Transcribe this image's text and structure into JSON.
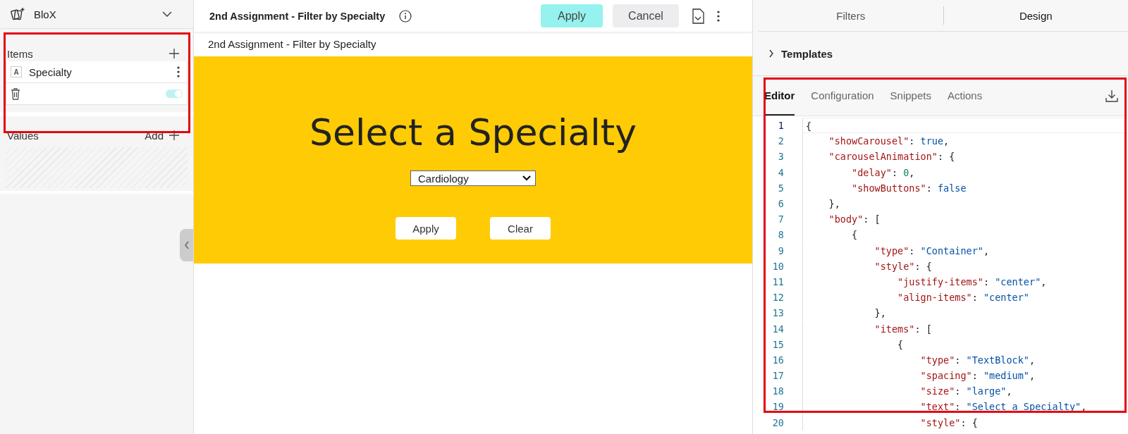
{
  "sidebar": {
    "app_name": "BloX",
    "items_section": {
      "title": "Items",
      "items": [
        {
          "label": "Specialty",
          "type_badge": "A"
        }
      ],
      "toggle": {
        "on": true
      }
    },
    "values_section": {
      "title": "Values",
      "add_label": "Add"
    }
  },
  "header": {
    "title": "2nd Assignment - Filter by Specialty",
    "buttons": [
      {
        "label": "Apply",
        "kind": "primary"
      },
      {
        "label": "Cancel",
        "kind": "secondary"
      }
    ]
  },
  "preview": {
    "caption": "2nd Assignment - Filter by Specialty",
    "heading": "Select a Specialty",
    "dropdown": {
      "value": "Cardiology"
    },
    "buttons": [
      "Apply",
      "Clear"
    ]
  },
  "right_panel": {
    "tabs": [
      {
        "label": "Filters",
        "selected": false
      },
      {
        "label": "Design",
        "selected": true
      }
    ],
    "templates": {
      "label": "Templates",
      "expanded": false
    },
    "editor_tabs": [
      {
        "label": "Editor",
        "selected": true
      },
      {
        "label": "Configuration",
        "selected": false
      },
      {
        "label": "Snippets",
        "selected": false
      },
      {
        "label": "Actions",
        "selected": false
      }
    ],
    "code_lines": [
      {
        "number": "1",
        "current": true,
        "tokens": [
          {
            "kind": "punct",
            "text": "{"
          }
        ]
      },
      {
        "number": "2",
        "current": false,
        "tokens": [
          {
            "kind": "key",
            "text": "    \"showCarousel\""
          },
          {
            "kind": "punct",
            "text": ": "
          },
          {
            "kind": "bool",
            "text": "true"
          },
          {
            "kind": "punct",
            "text": ","
          }
        ]
      },
      {
        "number": "3",
        "current": false,
        "tokens": [
          {
            "kind": "key",
            "text": "    \"carouselAnimation\""
          },
          {
            "kind": "punct",
            "text": ": {"
          }
        ]
      },
      {
        "number": "4",
        "current": false,
        "tokens": [
          {
            "kind": "key",
            "text": "        \"delay\""
          },
          {
            "kind": "punct",
            "text": ": "
          },
          {
            "kind": "num",
            "text": "0"
          },
          {
            "kind": "punct",
            "text": ","
          }
        ]
      },
      {
        "number": "5",
        "current": false,
        "tokens": [
          {
            "kind": "key",
            "text": "        \"showButtons\""
          },
          {
            "kind": "punct",
            "text": ": "
          },
          {
            "kind": "bool",
            "text": "false"
          }
        ]
      },
      {
        "number": "6",
        "current": false,
        "tokens": [
          {
            "kind": "punct",
            "text": "    },"
          }
        ]
      },
      {
        "number": "7",
        "current": false,
        "tokens": [
          {
            "kind": "key",
            "text": "    \"body\""
          },
          {
            "kind": "punct",
            "text": ": ["
          }
        ]
      },
      {
        "number": "8",
        "current": false,
        "tokens": [
          {
            "kind": "punct",
            "text": "        {"
          }
        ]
      },
      {
        "number": "9",
        "current": false,
        "tokens": [
          {
            "kind": "key",
            "text": "            \"type\""
          },
          {
            "kind": "punct",
            "text": ": "
          },
          {
            "kind": "str",
            "text": "\"Container\""
          },
          {
            "kind": "punct",
            "text": ","
          }
        ]
      },
      {
        "number": "10",
        "current": false,
        "tokens": [
          {
            "kind": "key",
            "text": "            \"style\""
          },
          {
            "kind": "punct",
            "text": ": {"
          }
        ]
      },
      {
        "number": "11",
        "current": false,
        "tokens": [
          {
            "kind": "key",
            "text": "                \"justify-items\""
          },
          {
            "kind": "punct",
            "text": ": "
          },
          {
            "kind": "str",
            "text": "\"center\""
          },
          {
            "kind": "punct",
            "text": ","
          }
        ]
      },
      {
        "number": "12",
        "current": false,
        "tokens": [
          {
            "kind": "key",
            "text": "                \"align-items\""
          },
          {
            "kind": "punct",
            "text": ": "
          },
          {
            "kind": "str",
            "text": "\"center\""
          }
        ]
      },
      {
        "number": "13",
        "current": false,
        "tokens": [
          {
            "kind": "punct",
            "text": "            },"
          }
        ]
      },
      {
        "number": "14",
        "current": false,
        "tokens": [
          {
            "kind": "key",
            "text": "            \"items\""
          },
          {
            "kind": "punct",
            "text": ": ["
          }
        ]
      },
      {
        "number": "15",
        "current": false,
        "tokens": [
          {
            "kind": "punct",
            "text": "                {"
          }
        ]
      },
      {
        "number": "16",
        "current": false,
        "tokens": [
          {
            "kind": "key",
            "text": "                    \"type\""
          },
          {
            "kind": "punct",
            "text": ": "
          },
          {
            "kind": "str",
            "text": "\"TextBlock\""
          },
          {
            "kind": "punct",
            "text": ","
          }
        ]
      },
      {
        "number": "17",
        "current": false,
        "tokens": [
          {
            "kind": "key",
            "text": "                    \"spacing\""
          },
          {
            "kind": "punct",
            "text": ": "
          },
          {
            "kind": "str",
            "text": "\"medium\""
          },
          {
            "kind": "punct",
            "text": ","
          }
        ]
      },
      {
        "number": "18",
        "current": false,
        "tokens": [
          {
            "kind": "key",
            "text": "                    \"size\""
          },
          {
            "kind": "punct",
            "text": ": "
          },
          {
            "kind": "str",
            "text": "\"large\""
          },
          {
            "kind": "punct",
            "text": ","
          }
        ]
      },
      {
        "number": "19",
        "current": false,
        "tokens": [
          {
            "kind": "key",
            "text": "                    \"text\""
          },
          {
            "kind": "punct",
            "text": ": "
          },
          {
            "kind": "str",
            "text": "\"Select a Specialty\""
          },
          {
            "kind": "punct",
            "text": ","
          }
        ]
      },
      {
        "number": "20",
        "current": false,
        "tokens": [
          {
            "kind": "key",
            "text": "                    \"style\""
          },
          {
            "kind": "punct",
            "text": ": {"
          }
        ]
      }
    ]
  }
}
